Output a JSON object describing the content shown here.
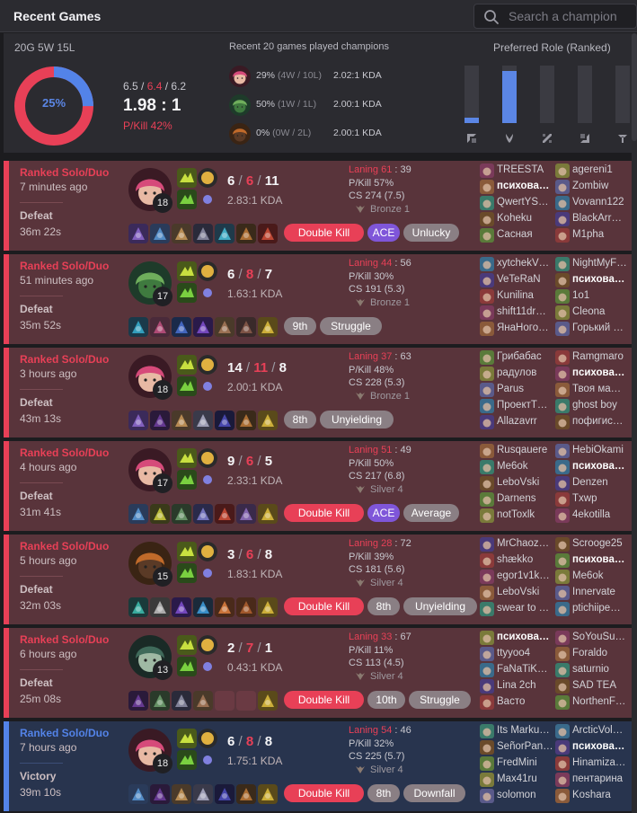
{
  "header": {
    "title": "Recent Games",
    "search_placeholder": "Search a champion"
  },
  "summary": {
    "record": "20G 5W 15L",
    "winrate_label": "25%",
    "winrate": 0.25,
    "avg_kills": "6.5",
    "avg_deaths": "6.4",
    "avg_assists": "6.2",
    "kda": "1.98 : 1",
    "pkill": "P/Kill 42%",
    "recent_title": "Recent 20 games played champions",
    "champions": [
      {
        "icon": "vi-portrait",
        "pct": "29%",
        "record": "(4W / 10L)",
        "kda": "2.02:1 KDA"
      },
      {
        "icon": "amumu-portrait",
        "pct": "50%",
        "record": "(1W / 1L)",
        "kda": "2.00:1 KDA"
      },
      {
        "icon": "volibear-portrait",
        "pct": "0%",
        "record": "(0W / 2L)",
        "kda": "2.00:1 KDA"
      }
    ],
    "role_title": "Preferred Role (Ranked)",
    "roles": [
      {
        "name": "top",
        "share": 0.1,
        "icon": "top-lane-icon"
      },
      {
        "name": "jungle",
        "share": 0.9,
        "icon": "jungle-icon"
      },
      {
        "name": "mid",
        "share": 0.0,
        "icon": "mid-lane-icon"
      },
      {
        "name": "adc",
        "share": 0.0,
        "icon": "bot-lane-icon"
      },
      {
        "name": "support",
        "share": 0.0,
        "icon": "support-icon"
      }
    ]
  },
  "games": [
    {
      "result_class": "loss",
      "queue": "Ranked Solo/Duo",
      "ago": "7 minutes ago",
      "result": "Defeat",
      "duration": "36m 22s",
      "champ": "vi",
      "level": "18",
      "k": "6",
      "d": "6",
      "a": "11",
      "kda": "2.83:1 KDA",
      "lane_label": "Laning 61",
      "lane_sep": " : ",
      "lane_opp": "39",
      "pkill": "P/Kill 57%",
      "cs": "CS 274 (7.5)",
      "tier": "Bronze 1",
      "items": [
        "item-a",
        "item-b",
        "item-c",
        "item-d",
        "item-e",
        "item-f",
        "item-g"
      ],
      "tags": [
        {
          "t": "Double Kill",
          "c": "red"
        },
        {
          "t": "ACE",
          "c": "purple"
        },
        {
          "t": "Unlucky",
          "c": "gray"
        }
      ],
      "players": [
        "TREESTA",
        "психова…",
        "QwertYS…",
        "Koheku",
        "Сасная",
        "agereni1",
        "Zombiw",
        "Vovann122",
        "BlackArr…",
        "M1pha"
      ],
      "me": 1
    },
    {
      "result_class": "loss",
      "queue": "Ranked Solo/Duo",
      "ago": "51 minutes ago",
      "result": "Defeat",
      "duration": "35m 52s",
      "champ": "amumu",
      "level": "17",
      "k": "6",
      "d": "8",
      "a": "7",
      "kda": "1.63:1 KDA",
      "lane_label": "Laning 44",
      "lane_sep": " : ",
      "lane_opp": "56",
      "pkill": "P/Kill 30%",
      "cs": "CS 191 (5.3)",
      "tier": "Bronze 1",
      "items": [
        "item-h",
        "item-i",
        "item-j",
        "item-k",
        "item-l",
        "item-m",
        "item-n"
      ],
      "tags": [
        {
          "t": "9th",
          "c": "gray"
        },
        {
          "t": "Struggle",
          "c": "gray"
        }
      ],
      "players": [
        "xytchekV…",
        "VeTeRaN",
        "Kunilina",
        "shift11dr…",
        "ЯнаНого…",
        "NightMyF…",
        "психова…",
        "1o1",
        "Cleona",
        "Горький …"
      ],
      "me": 6
    },
    {
      "result_class": "loss",
      "queue": "Ranked Solo/Duo",
      "ago": "3 hours ago",
      "result": "Defeat",
      "duration": "43m 13s",
      "champ": "vi",
      "level": "18",
      "k": "14",
      "d": "11",
      "a": "8",
      "kda": "2.00:1 KDA",
      "lane_label": "Laning 37",
      "lane_sep": " : ",
      "lane_opp": "63",
      "pkill": "P/Kill 48%",
      "cs": "CS 228 (5.3)",
      "tier": "Bronze 1",
      "items": [
        "item-a",
        "item-o",
        "item-c",
        "item-p",
        "item-q",
        "item-f",
        "item-n"
      ],
      "tags": [
        {
          "t": "8th",
          "c": "gray"
        },
        {
          "t": "Unyielding",
          "c": "gray"
        }
      ],
      "players": [
        "Грибабас",
        "радулов",
        "Parus",
        "ПроектТ…",
        "Allazavrr",
        "Ramgmaro",
        "психова…",
        "Твоя ма…",
        "ghost boy",
        "пофигис…"
      ],
      "me": 6
    },
    {
      "result_class": "loss",
      "queue": "Ranked Solo/Duo",
      "ago": "4 hours ago",
      "result": "Defeat",
      "duration": "31m 41s",
      "champ": "vi",
      "level": "17",
      "k": "9",
      "d": "6",
      "a": "5",
      "kda": "2.33:1 KDA",
      "lane_label": "Laning 51",
      "lane_sep": " : ",
      "lane_opp": "49",
      "pkill": "P/Kill 50%",
      "cs": "CS 217 (6.8)",
      "tier": "Silver 4",
      "items": [
        "item-b",
        "item-r",
        "item-s",
        "item-t",
        "item-g",
        "item-u",
        "item-n"
      ],
      "tags": [
        {
          "t": "Double Kill",
          "c": "red"
        },
        {
          "t": "ACE",
          "c": "purple"
        },
        {
          "t": "Average",
          "c": "gray"
        }
      ],
      "players": [
        "Rusqauere",
        "Me6ok",
        "LeboVski",
        "Darnens",
        "notToxlk",
        "HebiOkami",
        "психова…",
        "Denzen",
        "Txwp",
        "4ekotilla"
      ],
      "me": 6
    },
    {
      "result_class": "loss",
      "queue": "Ranked Solo/Duo",
      "ago": "5 hours ago",
      "result": "Defeat",
      "duration": "32m 03s",
      "champ": "volibear",
      "level": "15",
      "k": "3",
      "d": "6",
      "a": "8",
      "kda": "1.83:1 KDA",
      "lane_label": "Laning 28",
      "lane_sep": " : ",
      "lane_opp": "72",
      "pkill": "P/Kill 39%",
      "cs": "CS 181 (5.6)",
      "tier": "Silver 4",
      "items": [
        "item-v",
        "item-w",
        "item-k",
        "item-x",
        "item-y",
        "item-z",
        "item-n"
      ],
      "tags": [
        {
          "t": "Double Kill",
          "c": "red"
        },
        {
          "t": "8th",
          "c": "gray"
        },
        {
          "t": "Unyielding",
          "c": "gray"
        }
      ],
      "players": [
        "MrChaoz…",
        "shækko",
        "egor1v1k…",
        "LeboVski",
        "swear to …",
        "Scrooge25",
        "психова…",
        "Me6ok",
        "Innervate",
        "ptichiipe…"
      ],
      "me": 6
    },
    {
      "result_class": "loss",
      "queue": "Ranked Solo/Duo",
      "ago": "6 hours ago",
      "result": "Defeat",
      "duration": "25m 08s",
      "champ": "khazix",
      "level": "13",
      "k": "2",
      "d": "7",
      "a": "1",
      "kda": "0.43:1 KDA",
      "lane_label": "Laning 33",
      "lane_sep": " : ",
      "lane_opp": "67",
      "pkill": "P/Kill 11%",
      "cs": "CS 113 (4.5)",
      "tier": "Silver 4",
      "items": [
        "item-o",
        "item-s",
        "item-d",
        "item-l",
        "",
        "",
        "item-n"
      ],
      "tags": [
        {
          "t": "Double Kill",
          "c": "red"
        },
        {
          "t": "10th",
          "c": "gray"
        },
        {
          "t": "Struggle",
          "c": "gray"
        }
      ],
      "players": [
        "психова…",
        "ttyyoo4",
        "FaNaTiK…",
        "Lina 2ch",
        "Васто",
        "SoYouSu…",
        "Foraldo",
        "saturnio",
        "SAD TEA",
        "NorthenF…"
      ],
      "me": 0
    },
    {
      "result_class": "win",
      "queue": "Ranked Solo/Duo",
      "ago": "7 hours ago",
      "result": "Victory",
      "duration": "39m 10s",
      "champ": "vi",
      "level": "18",
      "k": "6",
      "d": "8",
      "a": "8",
      "kda": "1.75:1 KDA",
      "lane_label": "Laning 54",
      "lane_sep": " : ",
      "lane_opp": "46",
      "pkill": "P/Kill 32%",
      "cs": "CS 225 (5.7)",
      "tier": "Silver 4",
      "items": [
        "item-b",
        "item-o",
        "item-c",
        "item-p",
        "item-q",
        "item-f",
        "item-n"
      ],
      "tags": [
        {
          "t": "Double Kill",
          "c": "red"
        },
        {
          "t": "8th",
          "c": "gray"
        },
        {
          "t": "Downfall",
          "c": "gray"
        }
      ],
      "players": [
        "Its Marku…",
        "SeñorPan…",
        "FredMini",
        "Max41ru",
        "solomon",
        "ArcticVol…",
        "психова…",
        "Hinamiza…",
        "пентарина",
        "Koshara"
      ],
      "me": 6
    }
  ]
}
